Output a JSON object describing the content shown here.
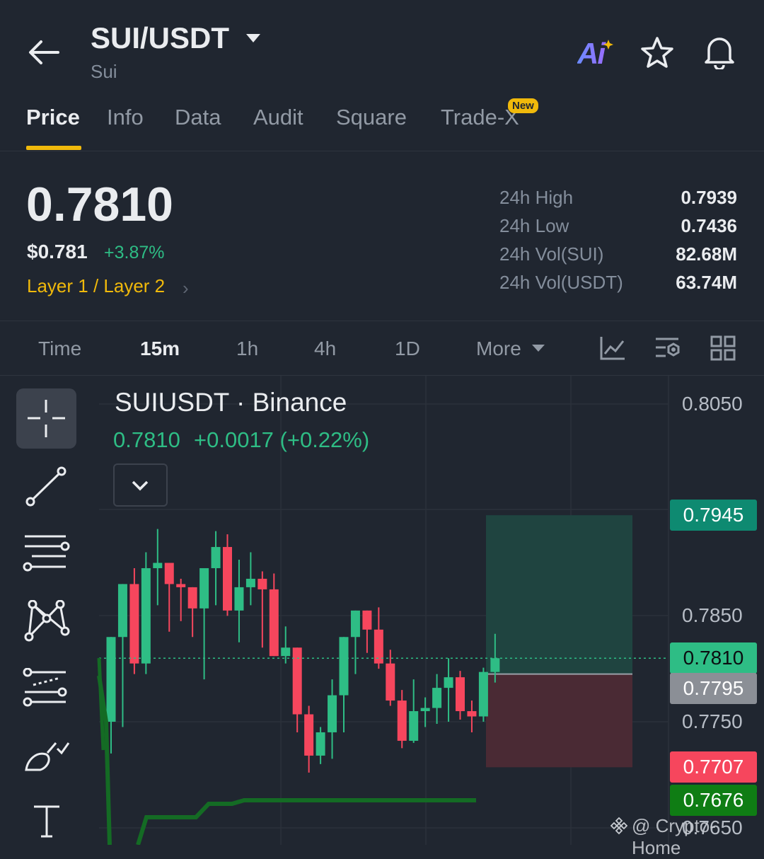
{
  "header": {
    "pair": "SUI/USDT",
    "asset_name": "Sui",
    "ai_label": "Ai",
    "icons": [
      "back-arrow-icon",
      "caret-down-icon",
      "ai-icon",
      "star-icon",
      "bell-icon"
    ]
  },
  "tabs": [
    {
      "label": "Price",
      "active": true
    },
    {
      "label": "Info"
    },
    {
      "label": "Data"
    },
    {
      "label": "Audit"
    },
    {
      "label": "Square"
    },
    {
      "label": "Trade-X",
      "badge": "New"
    }
  ],
  "price": {
    "last": "0.7810",
    "usd": "$0.781",
    "change_pct": "+3.87%",
    "category": "Layer 1 / Layer 2"
  },
  "stats": [
    {
      "label": "24h High",
      "value": "0.7939"
    },
    {
      "label": "24h Low",
      "value": "0.7436"
    },
    {
      "label": "24h Vol(SUI)",
      "value": "82.68M"
    },
    {
      "label": "24h Vol(USDT)",
      "value": "63.74M"
    }
  ],
  "intervals": {
    "time": "Time",
    "m15": "15m",
    "h1": "1h",
    "h4": "4h",
    "d1": "1D",
    "more": "More",
    "selected": "15m"
  },
  "chart": {
    "symbol": "SUIUSDT · Binance",
    "last": "0.7810",
    "change": "+0.0017 (+0.22%)",
    "watermark": "@ Crypto-Home",
    "axis_labels": [
      "0.8050",
      "0.7850",
      "0.7750",
      "0.7650"
    ],
    "price_tags": {
      "take_profit": "0.7945",
      "last": "0.7810",
      "entry": "0.7795",
      "stop": "0.7707",
      "line": "0.7676"
    },
    "colors": {
      "up": "#2ebd85",
      "down": "#f6465d",
      "accent": "#f0b90b"
    }
  },
  "chart_data": {
    "type": "candlestick",
    "ylim": [
      0.763,
      0.8075
    ],
    "candles": [
      {
        "o": 0.775,
        "h": 0.78,
        "l": 0.772,
        "c": 0.783
      },
      {
        "o": 0.783,
        "h": 0.784,
        "l": 0.7745,
        "c": 0.788
      },
      {
        "o": 0.788,
        "h": 0.7895,
        "l": 0.7795,
        "c": 0.7805
      },
      {
        "o": 0.7805,
        "h": 0.791,
        "l": 0.7795,
        "c": 0.7895
      },
      {
        "o": 0.7895,
        "h": 0.7932,
        "l": 0.786,
        "c": 0.79
      },
      {
        "o": 0.79,
        "h": 0.7895,
        "l": 0.7835,
        "c": 0.788
      },
      {
        "o": 0.788,
        "h": 0.7885,
        "l": 0.7845,
        "c": 0.7877
      },
      {
        "o": 0.7877,
        "h": 0.7872,
        "l": 0.783,
        "c": 0.7857
      },
      {
        "o": 0.7857,
        "h": 0.7875,
        "l": 0.779,
        "c": 0.7895
      },
      {
        "o": 0.7895,
        "h": 0.793,
        "l": 0.786,
        "c": 0.7915
      },
      {
        "o": 0.7915,
        "h": 0.7927,
        "l": 0.785,
        "c": 0.7855
      },
      {
        "o": 0.7855,
        "h": 0.7903,
        "l": 0.7825,
        "c": 0.7877
      },
      {
        "o": 0.7877,
        "h": 0.791,
        "l": 0.786,
        "c": 0.7885
      },
      {
        "o": 0.7885,
        "h": 0.7892,
        "l": 0.782,
        "c": 0.7875
      },
      {
        "o": 0.7875,
        "h": 0.789,
        "l": 0.782,
        "c": 0.7812
      },
      {
        "o": 0.7812,
        "h": 0.784,
        "l": 0.7805,
        "c": 0.782
      },
      {
        "o": 0.782,
        "h": 0.782,
        "l": 0.774,
        "c": 0.7757
      },
      {
        "o": 0.7757,
        "h": 0.7765,
        "l": 0.7702,
        "c": 0.7718
      },
      {
        "o": 0.7718,
        "h": 0.7745,
        "l": 0.771,
        "c": 0.774
      },
      {
        "o": 0.774,
        "h": 0.779,
        "l": 0.7715,
        "c": 0.7775
      },
      {
        "o": 0.7775,
        "h": 0.7822,
        "l": 0.774,
        "c": 0.783
      },
      {
        "o": 0.783,
        "h": 0.7835,
        "l": 0.7795,
        "c": 0.7855
      },
      {
        "o": 0.7855,
        "h": 0.785,
        "l": 0.7815,
        "c": 0.7837
      },
      {
        "o": 0.7837,
        "h": 0.7858,
        "l": 0.78,
        "c": 0.7805
      },
      {
        "o": 0.7805,
        "h": 0.7818,
        "l": 0.7765,
        "c": 0.777
      },
      {
        "o": 0.777,
        "h": 0.778,
        "l": 0.7725,
        "c": 0.7732
      },
      {
        "o": 0.7732,
        "h": 0.779,
        "l": 0.773,
        "c": 0.776
      },
      {
        "o": 0.776,
        "h": 0.7773,
        "l": 0.7745,
        "c": 0.7763
      },
      {
        "o": 0.7763,
        "h": 0.7795,
        "l": 0.7748,
        "c": 0.7782
      },
      {
        "o": 0.7782,
        "h": 0.781,
        "l": 0.775,
        "c": 0.7792
      },
      {
        "o": 0.7792,
        "h": 0.7798,
        "l": 0.7752,
        "c": 0.776
      },
      {
        "o": 0.776,
        "h": 0.777,
        "l": 0.774,
        "c": 0.7755
      },
      {
        "o": 0.7755,
        "h": 0.7801,
        "l": 0.775,
        "c": 0.7797
      },
      {
        "o": 0.7797,
        "h": 0.7833,
        "l": 0.7787,
        "c": 0.781
      }
    ],
    "position_box": {
      "take_profit": 0.7945,
      "entry": 0.7795,
      "stop": 0.7707
    },
    "last_price": 0.781
  }
}
